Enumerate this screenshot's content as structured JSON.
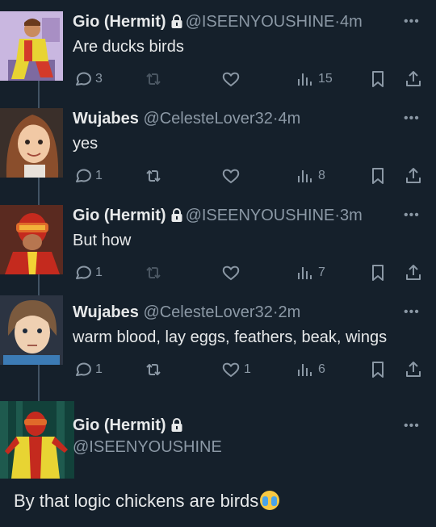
{
  "tweets": [
    {
      "name": "Gio (Hermit)",
      "handle": "@ISEENYOUSHINE",
      "sep": "·",
      "time": "4m",
      "text": "Are ducks birds",
      "replies": "3",
      "likes": "",
      "views": "15"
    },
    {
      "name": "Wujabes",
      "handle": "@CelesteLover32",
      "sep": "·",
      "time": "4m",
      "text": "yes",
      "replies": "1",
      "likes": "",
      "views": "8"
    },
    {
      "name": "Gio (Hermit)",
      "handle": "@ISEENYOUSHINE",
      "sep": "·",
      "time": "3m",
      "text": "But how",
      "replies": "1",
      "likes": "",
      "views": "7"
    },
    {
      "name": "Wujabes",
      "handle": "@CelesteLover32",
      "sep": "·",
      "time": "2m",
      "text": "warm blood, lay eggs, feathers, beak, wings",
      "replies": "1",
      "likes": "1",
      "views": "6"
    }
  ],
  "focused": {
    "name": "Gio (Hermit)",
    "handle": "@ISEENYOUSHINE",
    "text": "By that logic chickens are birds",
    "emoji": "loudly-crying-face"
  },
  "more_glyph": "•••",
  "colors": {
    "background": "#15202b",
    "muted": "#8b98a5",
    "text": "#e7e9ea",
    "thread_line": "#425364"
  }
}
